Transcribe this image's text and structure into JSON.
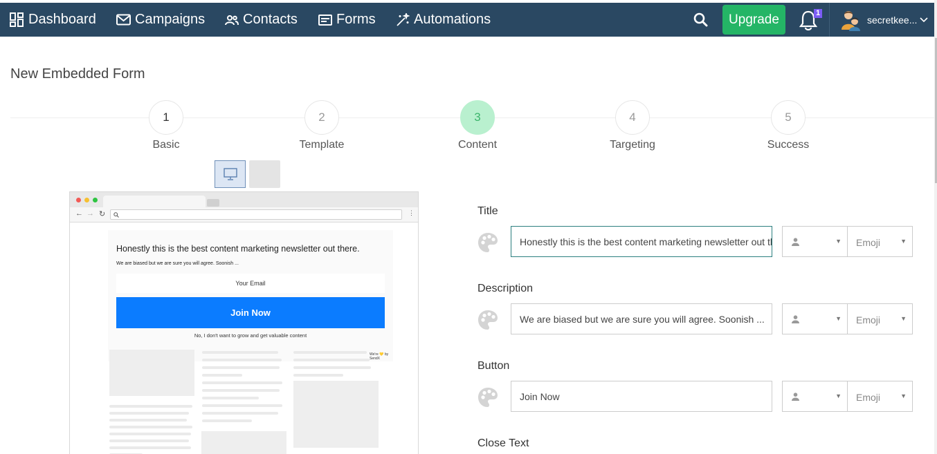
{
  "nav": {
    "items": [
      {
        "label": "Dashboard",
        "icon": "dashboard-icon"
      },
      {
        "label": "Campaigns",
        "icon": "envelope-icon"
      },
      {
        "label": "Contacts",
        "icon": "users-icon"
      },
      {
        "label": "Forms",
        "icon": "form-icon"
      },
      {
        "label": "Automations",
        "icon": "magic-wand-icon"
      }
    ],
    "upgrade_label": "Upgrade",
    "notification_count": "1",
    "user_name": "secretkee..."
  },
  "page": {
    "title": "New Embedded Form"
  },
  "steps": [
    {
      "number": "1",
      "label": "Basic"
    },
    {
      "number": "2",
      "label": "Template"
    },
    {
      "number": "3",
      "label": "Content",
      "active": true
    },
    {
      "number": "4",
      "label": "Targeting"
    },
    {
      "number": "5",
      "label": "Success"
    }
  ],
  "preview": {
    "form_title": "Honestly this is the best content marketing newsletter out there.",
    "form_description": "We are biased but we are sure you will agree. Soonish ...",
    "email_placeholder": "Your Email",
    "button_label": "Join Now",
    "decline_text": "No, I don't want to grow and get valuable content",
    "credit": "We're 💛 by SendX"
  },
  "fields": [
    {
      "label": "Title",
      "value": "Honestly this is the best content marketing newsletter out there.",
      "emoji_label": "Emoji"
    },
    {
      "label": "Description",
      "value": "We are biased but we are sure you will agree. Soonish ...",
      "emoji_label": "Emoji"
    },
    {
      "label": "Button",
      "value": "Join Now",
      "emoji_label": "Emoji"
    },
    {
      "label": "Close Text"
    }
  ],
  "colors": {
    "navbar": "#2a4862",
    "upgrade": "#24b566",
    "active_step": "#b9f0cf",
    "join_button": "#0b7cff"
  }
}
